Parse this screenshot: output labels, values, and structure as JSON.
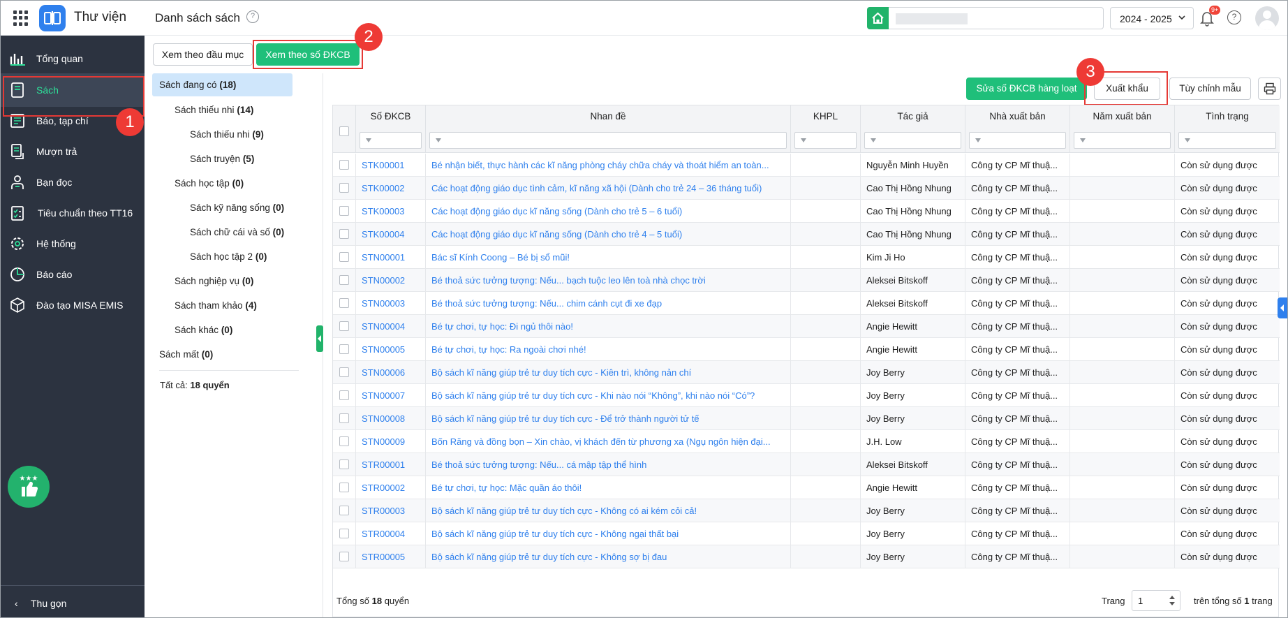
{
  "app": {
    "title": "Thư viện",
    "page_title": "Danh sách sách",
    "help": "?"
  },
  "header": {
    "year": "2024 - 2025",
    "notif_badge": "9+",
    "help": "?"
  },
  "sidebar": {
    "items": [
      {
        "label": "Tổng quan",
        "icon": "chart-bars-icon"
      },
      {
        "label": "Sách",
        "icon": "book-icon"
      },
      {
        "label": "Báo, tạp chí",
        "icon": "newspaper-icon"
      },
      {
        "label": "Mượn trả",
        "icon": "borrow-icon"
      },
      {
        "label": "Bạn đọc",
        "icon": "reader-icon"
      },
      {
        "label": "Tiêu chuẩn theo TT16",
        "icon": "checklist-icon"
      },
      {
        "label": "Hệ thống",
        "icon": "gear-icon"
      },
      {
        "label": "Báo cáo",
        "icon": "pie-chart-icon"
      },
      {
        "label": "Đào tạo MISA EMIS",
        "icon": "cube-icon"
      }
    ],
    "collapse_label": "Thu gọn"
  },
  "annotations": {
    "n1": "1",
    "n2": "2",
    "n3": "3"
  },
  "tabs": {
    "by_title": "Xem theo đầu mục",
    "by_dkcb": "Xem theo số ĐKCB"
  },
  "tree": {
    "items": [
      {
        "name": "Sách đang có",
        "count": "(18)"
      },
      {
        "name": "Sách thiếu nhi",
        "count": "(14)"
      },
      {
        "name": "Sách thiếu nhi",
        "count": "(9)"
      },
      {
        "name": "Sách truyện",
        "count": "(5)"
      },
      {
        "name": "Sách học tập",
        "count": "(0)"
      },
      {
        "name": "Sách kỹ năng sống",
        "count": "(0)"
      },
      {
        "name": "Sách chữ cái và số",
        "count": "(0)"
      },
      {
        "name": "Sách học tập 2",
        "count": "(0)"
      },
      {
        "name": "Sách nghiệp vụ",
        "count": "(0)"
      },
      {
        "name": "Sách tham khảo",
        "count": "(4)"
      },
      {
        "name": "Sách khác",
        "count": "(0)"
      },
      {
        "name": "Sách mất",
        "count": "(0)"
      }
    ],
    "total_prefix": "Tất cả:",
    "total_value": "18 quyển"
  },
  "toolbar": {
    "edit_batch": "Sửa số ĐKCB hàng loạt",
    "export": "Xuất khẩu",
    "customize": "Tùy chỉnh mẫu"
  },
  "table": {
    "columns": [
      "Số ĐKCB",
      "Nhan đề",
      "KHPL",
      "Tác giả",
      "Nhà xuất bản",
      "Năm xuất bản",
      "Tình trạng"
    ],
    "rows": [
      [
        "STK00001",
        "Bé nhận biết, thực hành các kĩ năng phòng cháy chữa cháy và thoát hiểm an toàn...",
        "",
        "Nguyễn Minh Huyền",
        "Công ty CP Mĩ thuậ...",
        "",
        "Còn sử dụng được"
      ],
      [
        "STK00002",
        "Các hoạt động giáo dục tình cảm, kĩ năng xã hội (Dành cho trẻ 24 – 36 tháng tuổi)",
        "",
        "Cao Thị Hồng Nhung",
        "Công ty CP Mĩ thuậ...",
        "",
        "Còn sử dụng được"
      ],
      [
        "STK00003",
        "Các hoạt động giáo dục kĩ năng sống (Dành cho trẻ 5 – 6 tuổi)",
        "",
        "Cao Thị Hồng Nhung",
        "Công ty CP Mĩ thuậ...",
        "",
        "Còn sử dụng được"
      ],
      [
        "STK00004",
        "Các hoạt động giáo dục kĩ năng sống (Dành cho trẻ 4 – 5 tuổi)",
        "",
        "Cao Thị Hồng Nhung",
        "Công ty CP Mĩ thuậ...",
        "",
        "Còn sử dụng được"
      ],
      [
        "STN00001",
        "Bác sĩ Kính Coong – Bé bị sổ mũi!",
        "",
        "Kim Ji Ho",
        "Công ty CP Mĩ thuậ...",
        "",
        "Còn sử dụng được"
      ],
      [
        "STN00002",
        "Bé thoả sức tưởng tượng: Nếu... bạch tuộc leo lên toà nhà chọc trời",
        "",
        "Aleksei Bitskoff",
        "Công ty CP Mĩ thuậ...",
        "",
        "Còn sử dụng được"
      ],
      [
        "STN00003",
        "Bé thoả sức tưởng tượng: Nếu... chim cánh cụt đi xe đạp",
        "",
        "Aleksei Bitskoff",
        "Công ty CP Mĩ thuậ...",
        "",
        "Còn sử dụng được"
      ],
      [
        "STN00004",
        "Bé tự chơi, tự học: Đi ngủ thôi nào!",
        "",
        "Angie Hewitt",
        "Công ty CP Mĩ thuậ...",
        "",
        "Còn sử dụng được"
      ],
      [
        "STN00005",
        "Bé tự chơi, tự học: Ra ngoài chơi nhé!",
        "",
        "Angie Hewitt",
        "Công ty CP Mĩ thuậ...",
        "",
        "Còn sử dụng được"
      ],
      [
        "STN00006",
        "Bộ sách kĩ năng giúp trẻ tư duy tích cực - Kiên trì, không nản chí",
        "",
        "Joy Berry",
        "Công ty CP Mĩ thuậ...",
        "",
        "Còn sử dụng được"
      ],
      [
        "STN00007",
        "Bộ sách kĩ năng giúp trẻ tư duy tích cực - Khi nào nói “Không”, khi nào nói “Có”?",
        "",
        "Joy Berry",
        "Công ty CP Mĩ thuậ...",
        "",
        "Còn sử dụng được"
      ],
      [
        "STN00008",
        "Bộ sách kĩ năng giúp trẻ tư duy tích cực - Để trở thành người tử tế",
        "",
        "Joy Berry",
        "Công ty CP Mĩ thuậ...",
        "",
        "Còn sử dụng được"
      ],
      [
        "STN00009",
        "Bốn Răng và đồng bọn – Xin chào, vị khách đến từ phương xa (Ngụ ngôn hiện đại...",
        "",
        "J.H. Low",
        "Công ty CP Mĩ thuậ...",
        "",
        "Còn sử dụng được"
      ],
      [
        "STR00001",
        "Bé thoả sức tưởng tượng: Nếu... cá mập tập thể hình",
        "",
        "Aleksei Bitskoff",
        "Công ty CP Mĩ thuậ...",
        "",
        "Còn sử dụng được"
      ],
      [
        "STR00002",
        "Bé tự chơi, tự học: Mặc quần áo thôi!",
        "",
        "Angie Hewitt",
        "Công ty CP Mĩ thuậ...",
        "",
        "Còn sử dụng được"
      ],
      [
        "STR00003",
        "Bộ sách kĩ năng giúp trẻ tư duy tích cực - Không có ai kém cỏi cả!",
        "",
        "Joy Berry",
        "Công ty CP Mĩ thuậ...",
        "",
        "Còn sử dụng được"
      ],
      [
        "STR00004",
        "Bộ sách kĩ năng giúp trẻ tư duy tích cực - Không ngại thất bại",
        "",
        "Joy Berry",
        "Công ty CP Mĩ thuậ...",
        "",
        "Còn sử dụng được"
      ],
      [
        "STR00005",
        "Bộ sách kĩ năng giúp trẻ tư duy tích cực - Không sợ bị đau",
        "",
        "Joy Berry",
        "Công ty CP Mĩ thuậ...",
        "",
        "Còn sử dụng được"
      ]
    ]
  },
  "footer": {
    "total_prefix": "Tổng số",
    "total_value": "18",
    "total_suffix": "quyển",
    "page_label": "Trang",
    "page_value": "1",
    "of_prefix": "trên tổng số",
    "of_value": "1",
    "of_suffix": "trang"
  },
  "colors": {
    "accent_green": "#1fbf7a",
    "link_blue": "#2f80ed",
    "sidebar_bg": "#2c3340",
    "highlight_red": "#e53935"
  }
}
